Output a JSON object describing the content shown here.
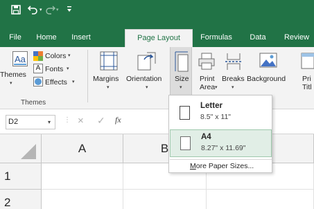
{
  "quick_access": {
    "save_icon": "save-icon",
    "undo_icon": "undo-icon",
    "redo_icon": "redo-icon",
    "customize_icon": "customize-quick-access-icon"
  },
  "tabs": [
    {
      "label": "File"
    },
    {
      "label": "Home"
    },
    {
      "label": "Insert"
    },
    {
      "label": "Page Layout"
    },
    {
      "label": "Formulas"
    },
    {
      "label": "Data"
    },
    {
      "label": "Review"
    }
  ],
  "ribbon": {
    "themes": {
      "themes_label": "Themes",
      "colors_label": "Colors",
      "fonts_label": "Fonts",
      "effects_label": "Effects",
      "group_label": "Themes"
    },
    "margins_label": "Margins",
    "orientation_label": "Orientation",
    "size_label": "Size",
    "print_area_line1": "Print",
    "print_area_line2": "Area",
    "breaks_label": "Breaks",
    "background_label": "Background",
    "print_titles_line1": "Pri",
    "print_titles_line2": "Titl"
  },
  "formula_bar": {
    "name_box": "D2",
    "cancel_glyph": "×",
    "enter_glyph": "✓",
    "fx_glyph": "fx"
  },
  "grid": {
    "columns": [
      "A",
      "B"
    ],
    "rows": [
      "1",
      "2"
    ]
  },
  "size_menu": {
    "items": [
      {
        "name": "Letter",
        "size": "8.5\" x 11\"",
        "selected": false
      },
      {
        "name": "A4",
        "size": "8.27\" x 11.69\"",
        "selected": true
      }
    ],
    "more_label": "More Paper Sizes..."
  },
  "colors": {
    "accent": "#217346",
    "ribbon_bg": "#f3f3f3",
    "selected_item_bg": "#e1eee6"
  }
}
